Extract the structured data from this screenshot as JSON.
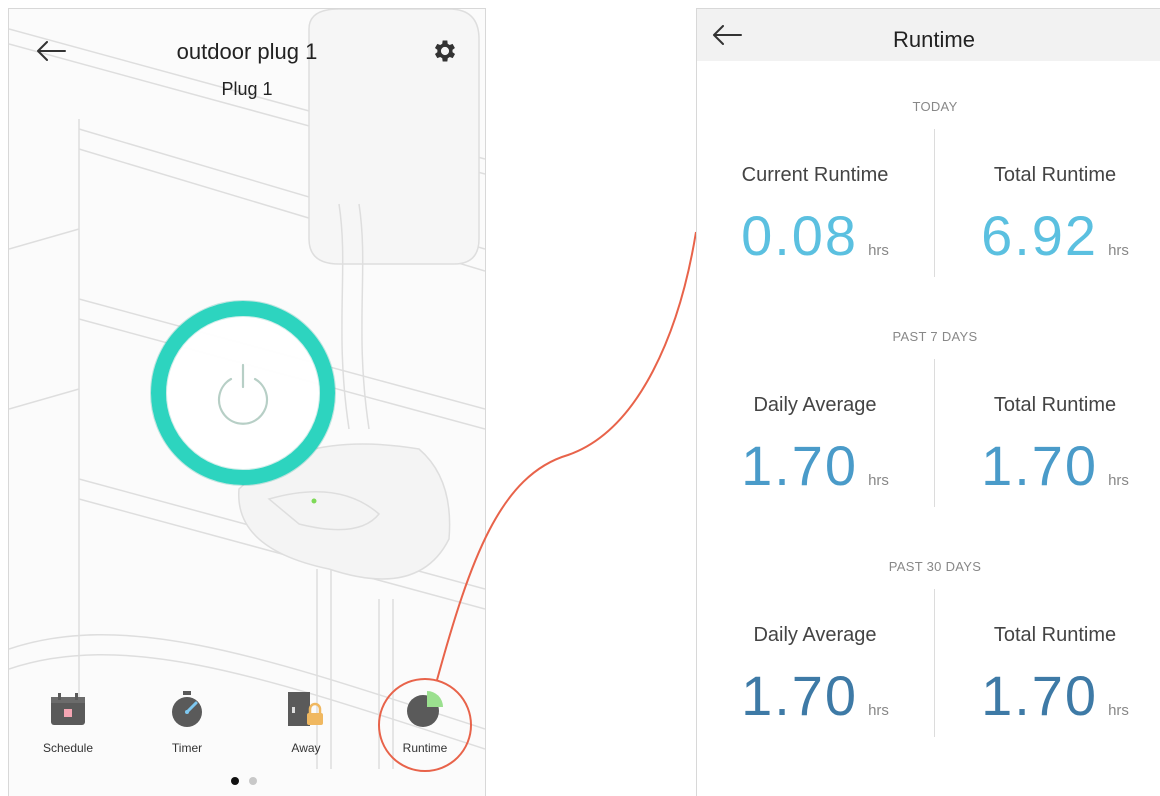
{
  "device": {
    "title": "outdoor plug 1",
    "subtitle": "Plug 1",
    "power_ring_color": "#2dd4bf"
  },
  "nav": {
    "items": [
      {
        "label": "Schedule",
        "icon": "calendar-icon"
      },
      {
        "label": "Timer",
        "icon": "stopwatch-icon"
      },
      {
        "label": "Away",
        "icon": "door-lock-icon"
      },
      {
        "label": "Runtime",
        "icon": "pie-chart-icon"
      }
    ],
    "page_count": 2,
    "active_page": 1
  },
  "callout_color": "#e8634a",
  "runtime": {
    "title": "Runtime",
    "sections": [
      {
        "title": "TODAY",
        "stats": [
          {
            "label": "Current Runtime",
            "value": "0.08",
            "unit": "hrs",
            "color": "#5bc0e0"
          },
          {
            "label": "Total Runtime",
            "value": "6.92",
            "unit": "hrs",
            "color": "#5bc0e0"
          }
        ]
      },
      {
        "title": "PAST 7 DAYS",
        "stats": [
          {
            "label": "Daily Average",
            "value": "1.70",
            "unit": "hrs",
            "color": "#4a9bc9"
          },
          {
            "label": "Total Runtime",
            "value": "1.70",
            "unit": "hrs",
            "color": "#4a9bc9"
          }
        ]
      },
      {
        "title": "PAST 30 DAYS",
        "stats": [
          {
            "label": "Daily Average",
            "value": "1.70",
            "unit": "hrs",
            "color": "#3e7aa6"
          },
          {
            "label": "Total Runtime",
            "value": "1.70",
            "unit": "hrs",
            "color": "#3e7aa6"
          }
        ]
      }
    ]
  }
}
